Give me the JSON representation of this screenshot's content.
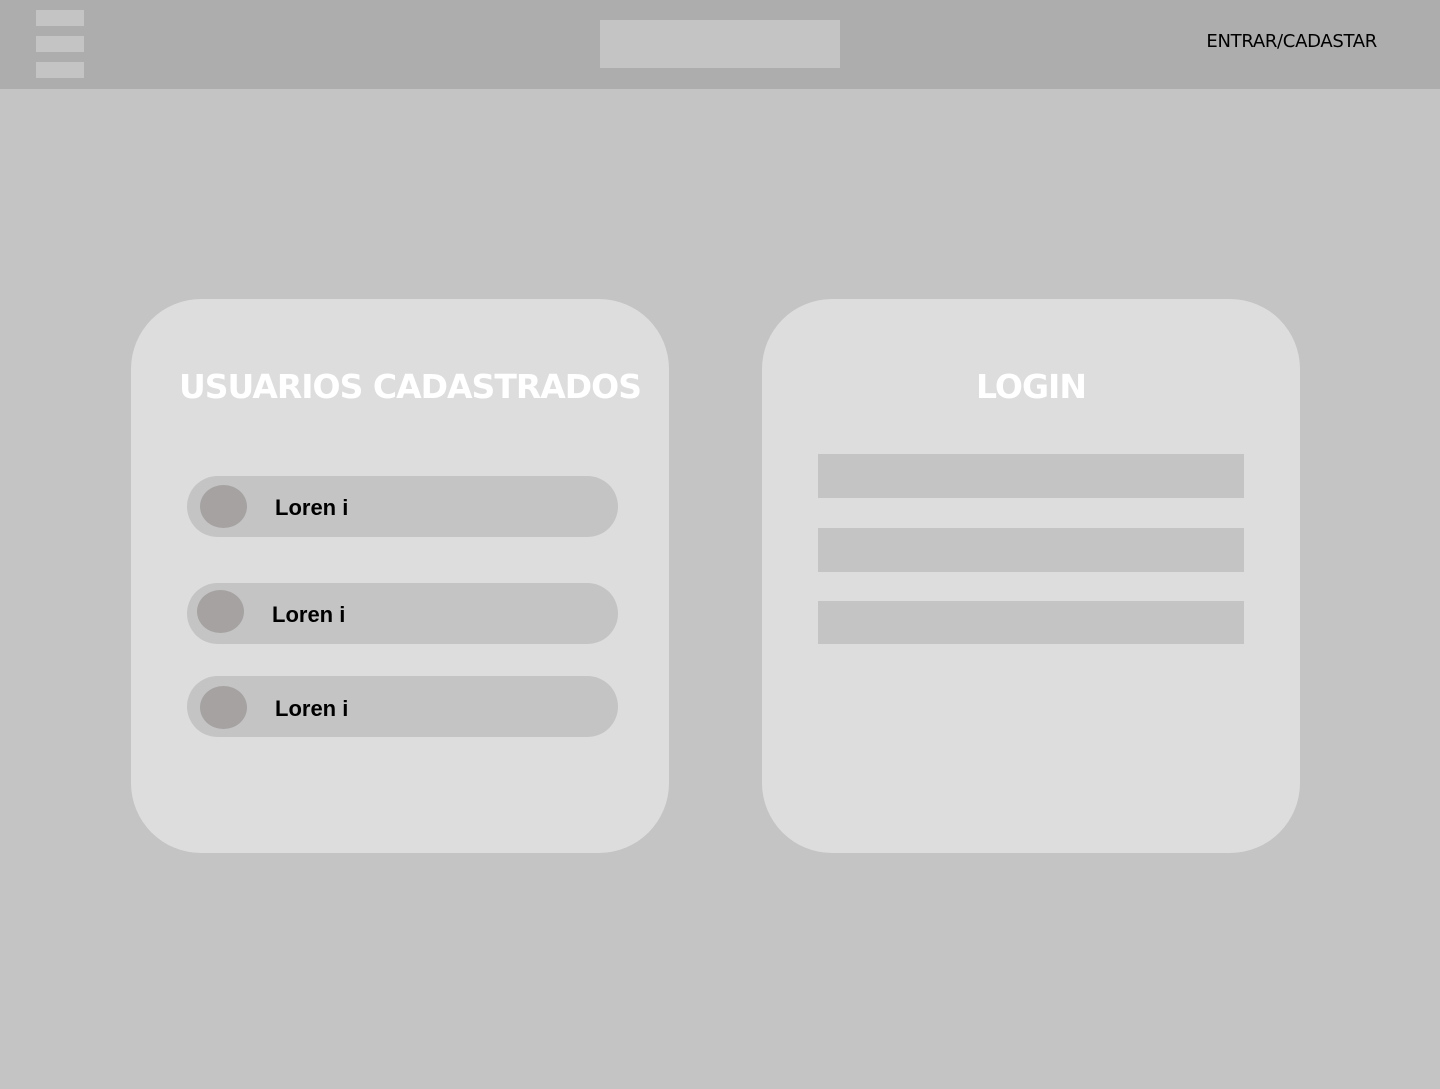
{
  "header": {
    "nav_link": "ENTRAR/CADASTAR"
  },
  "users_panel": {
    "title": "USUARIOS CADASTRADOS",
    "items": [
      {
        "name": "Loren i"
      },
      {
        "name": "Loren i"
      },
      {
        "name": "Loren i"
      }
    ]
  },
  "login_panel": {
    "title": "LOGIN",
    "fields": [
      {
        "value": ""
      },
      {
        "value": ""
      },
      {
        "value": ""
      }
    ]
  },
  "icons": {
    "menu": "hamburger-menu-icon",
    "avatar": "user-avatar-icon"
  },
  "colors": {
    "background": "#c4c4c4",
    "header": "#adadad",
    "card": "#dddddd",
    "placeholder": "#c4c4c4",
    "avatar": "#a6a2a2",
    "title_text": "#ffffff"
  }
}
